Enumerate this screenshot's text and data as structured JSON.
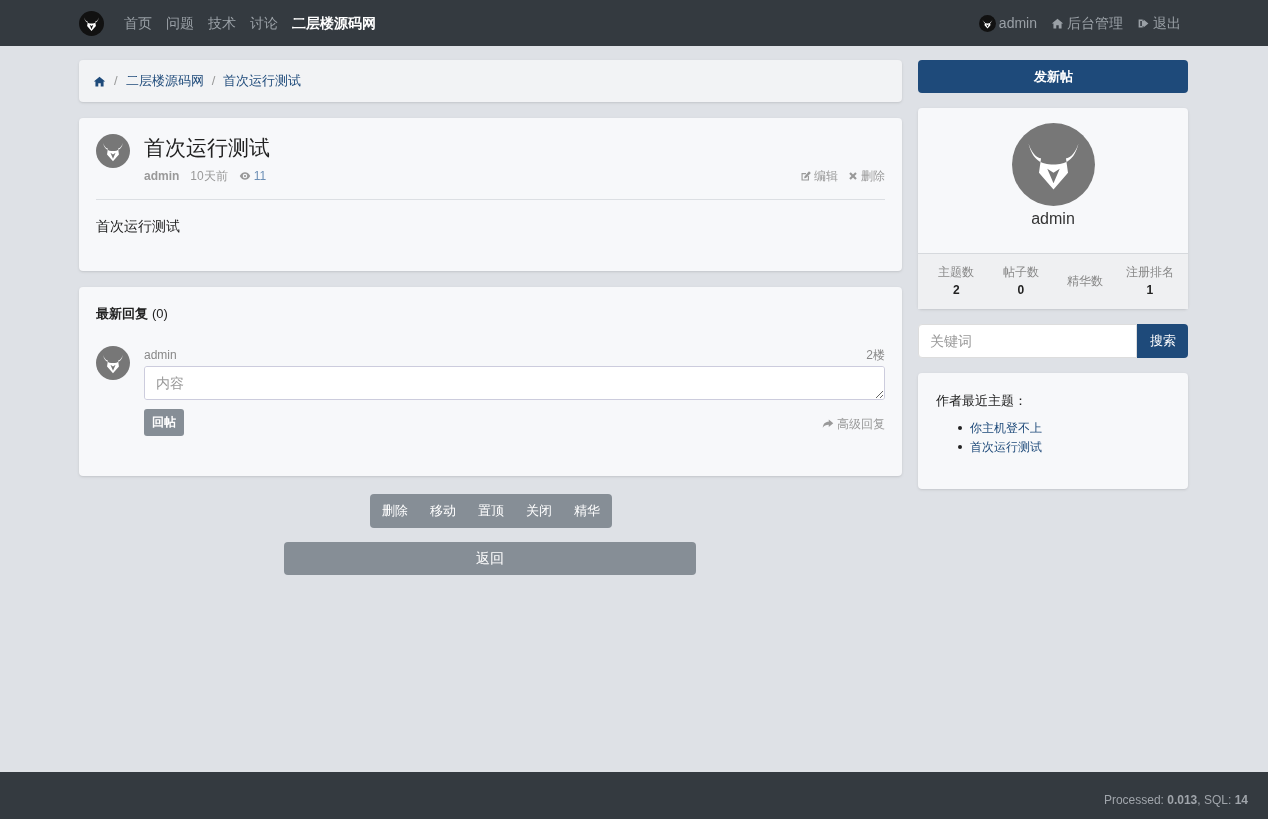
{
  "navbar": {
    "links": [
      {
        "label": "首页",
        "selected": false
      },
      {
        "label": "问题",
        "selected": false
      },
      {
        "label": "技术",
        "selected": false
      },
      {
        "label": "讨论",
        "selected": false
      },
      {
        "label": "二层楼源码网",
        "selected": true
      }
    ],
    "right": [
      {
        "kind": "user",
        "label": "admin"
      },
      {
        "kind": "admin",
        "label": "后台管理"
      },
      {
        "kind": "logout",
        "label": "退出"
      }
    ]
  },
  "breadcrumb": [
    {
      "separator": "/",
      "label": "二层楼源码网"
    },
    {
      "separator": "/",
      "label": "首次运行测试"
    }
  ],
  "thread": {
    "title": "首次运行测试",
    "author": "admin",
    "time": "10天前",
    "views": "11",
    "actions": [
      {
        "kind": "edit",
        "label": "编辑"
      },
      {
        "kind": "delete",
        "label": "删除"
      }
    ],
    "body": "首次运行测试"
  },
  "replies": {
    "title": "最新回复",
    "count": "(0)",
    "form": {
      "user": "admin",
      "floor": "2楼",
      "placeholder": "内容",
      "submit": "回帖",
      "advanced": "高级回复"
    }
  },
  "moderation": [
    "删除",
    "移动",
    "置顶",
    "关闭",
    "精华"
  ],
  "back": "返回",
  "sidebar": {
    "new_post": "发新帖",
    "profile": {
      "name": "admin",
      "stats": [
        {
          "label": "主题数",
          "value": "2"
        },
        {
          "label": "帖子数",
          "value": "0"
        },
        {
          "label": "精华数"
        },
        {
          "label": "注册排名",
          "value": "1"
        }
      ]
    },
    "search": {
      "placeholder": "关键词",
      "button": "搜索"
    },
    "recent": {
      "title": "作者最近主题：",
      "items": [
        "你主机登不上",
        "首次运行测试"
      ]
    }
  },
  "footer": "Processed: **0.013**, SQL: **14**"
}
